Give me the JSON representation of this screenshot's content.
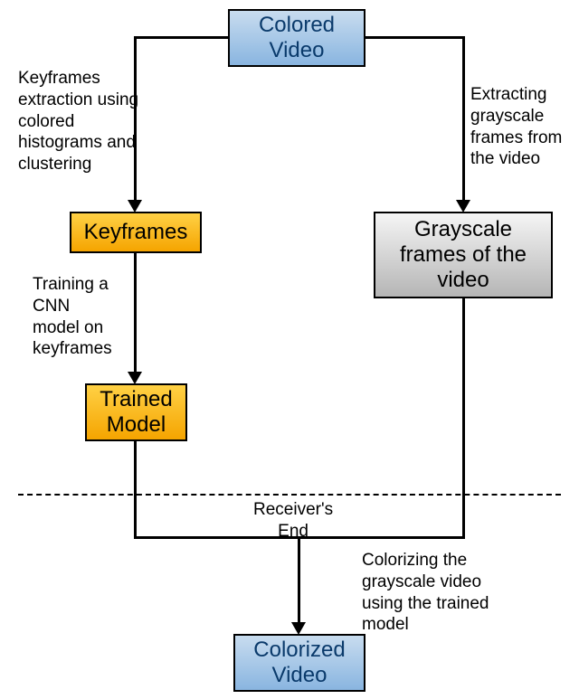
{
  "nodes": {
    "colored_video": "Colored\nVideo",
    "keyframes": "Keyframes",
    "trained_model": "Trained\nModel",
    "grayscale": "Grayscale\nframes of the\nvideo",
    "colorized_video": "Colorized\nVideo"
  },
  "labels": {
    "keyframes_extraction": "Keyframes\nextraction using\ncolored\nhistograms and\nclustering",
    "extracting_grayscale": "Extracting\ngrayscale\nframes from\nthe video",
    "training_cnn": "Training a\nCNN\nmodel on\nkeyframes",
    "receivers_end": "Receiver's\nEnd",
    "colorizing": "Colorizing the\ngrayscale video\nusing the trained\nmodel"
  }
}
